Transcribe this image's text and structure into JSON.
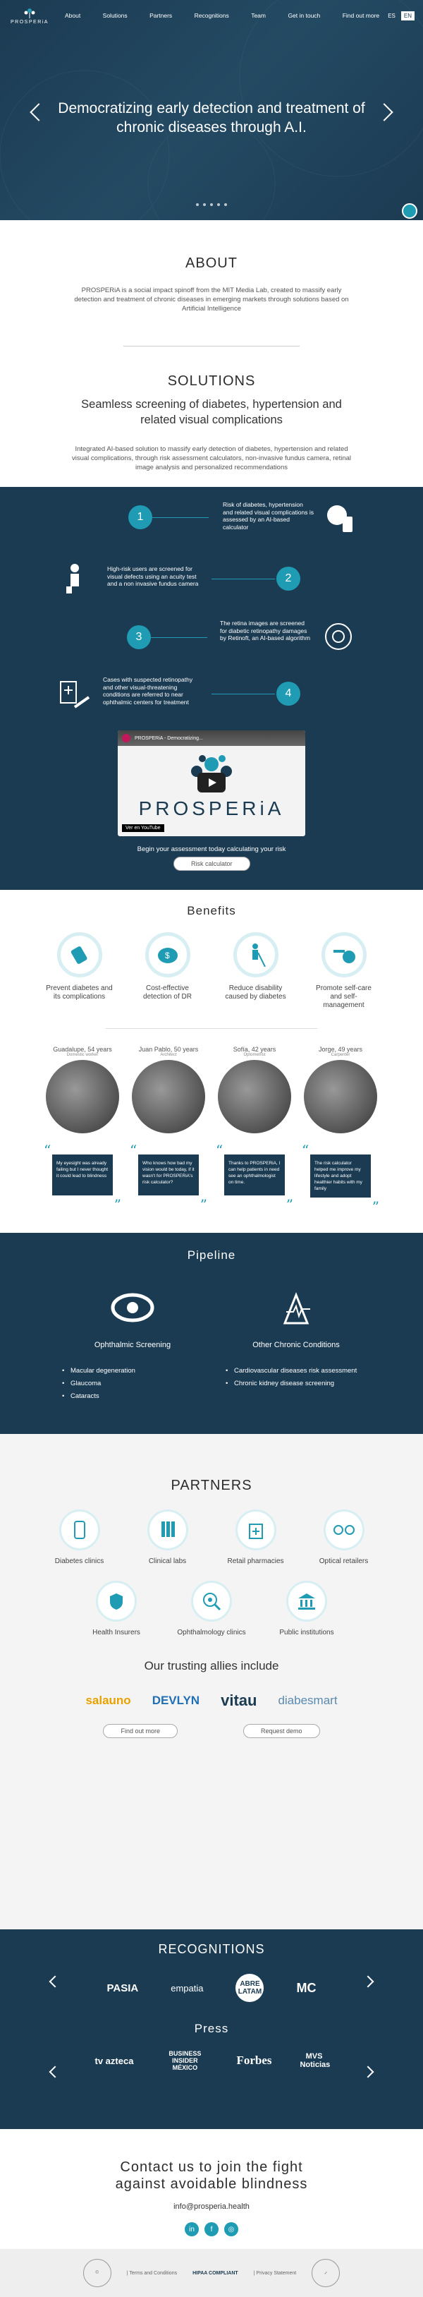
{
  "brand": "PROSPERiA",
  "nav": [
    "About",
    "Solutions",
    "Partners",
    "Recognitions",
    "Team",
    "Get in touch",
    "Find out more"
  ],
  "lang": [
    "ES",
    "EN"
  ],
  "hero": {
    "title": "Democratizing early detection and treatment of chronic diseases through A.I."
  },
  "about": {
    "title": "ABOUT",
    "text": "PROSPERiA is a social impact spinoff from the MIT Media Lab, created to massify early detection and treatment of chronic diseases in emerging markets through solutions based on Artificial Intelligence"
  },
  "solutions": {
    "title": "SOLUTIONS",
    "subtitle": "Seamless screening of diabetes, hypertension and related visual complications",
    "text": "Integrated AI-based solution to massify early detection of diabetes, hypertension and related visual complications, through risk assessment calculators, non-invasive fundus camera, retinal image analysis and personalized recommendations"
  },
  "steps": [
    {
      "n": "1",
      "text": "Risk of diabetes, hypertension and related visual complications is assessed by an AI-based calculator"
    },
    {
      "n": "2",
      "text": "High-risk users are screened for visual defects using an acuity test and a non invasive fundus camera"
    },
    {
      "n": "3",
      "text": "The retina images are screened for diabetic retinopathy damages by Retinoft, an AI-based algorithm"
    },
    {
      "n": "4",
      "text": "Cases with suspected retinopathy and other visual-threatening conditions are referred to near ophthalmic centers for treatment"
    }
  ],
  "video": {
    "title": "PROSPERiA - Democratizing...",
    "brand": "PROSPERiA",
    "watch": "Ver en YouTube"
  },
  "cta": {
    "text": "Begin your assessment today calculating your risk",
    "button": "Risk calculator"
  },
  "benefits": {
    "title": "Benefits",
    "items": [
      "Prevent diabetes and its complications",
      "Cost-effective detection of DR",
      "Reduce disability caused by diabetes",
      "Promote self-care and self-management"
    ]
  },
  "testimonials": [
    {
      "name": "Guadalupe, 54 years",
      "role": "Domestic worker",
      "quote": "My eyesight was already failing but I never thought it could lead to blindness"
    },
    {
      "name": "Juan Pablo, 50 years",
      "role": "Architect",
      "quote": "Who knows how bad my vision would be today, if it wasn't for PROSPERiA's risk calculator?"
    },
    {
      "name": "Sofía, 42 years",
      "role": "Optometrist",
      "quote": "Thanks to PROSPERiA, I can help patients in need see an ophthalmologist on time."
    },
    {
      "name": "Jorge, 49 years",
      "role": "Carpenter",
      "quote": "The risk calculator helped me improve my lifestyle and adopt healthier habits with my family"
    }
  ],
  "pipeline": {
    "title": "Pipeline",
    "col1": {
      "title": "Ophthalmic Screening",
      "items": [
        "Macular degeneration",
        "Glaucoma",
        "Cataracts"
      ]
    },
    "col2": {
      "title": "Other Chronic Conditions",
      "items": [
        "Cardiovascular diseases risk assessment",
        "Chronic kidney disease screening"
      ]
    }
  },
  "partners": {
    "title": "PARTNERS",
    "row1": [
      "Diabetes clinics",
      "Clinical labs",
      "Retail pharmacies",
      "Optical retailers"
    ],
    "row2": [
      "Health Insurers",
      "Ophthalmology clinics",
      "Public institutions"
    ],
    "allies_title": "Our trusting allies include",
    "allies": [
      "salauno",
      "DEVLYN",
      "vitau",
      "diabesmart"
    ],
    "buttons": [
      "Find out more",
      "Request demo"
    ]
  },
  "recognitions": {
    "title": "RECOGNITIONS",
    "logos": [
      "PASIA",
      "empatia",
      "ABRE LATAM",
      "MC"
    ]
  },
  "press": {
    "title": "Press",
    "logos": [
      "tv azteca",
      "BUSINESS INSIDER MÉXICO",
      "Forbes",
      "MVS Noticias"
    ]
  },
  "contact": {
    "title": "Contact us to join the fight against avoidable blindness",
    "email": "info@prosperia.health",
    "social": [
      "in",
      "f",
      "◎"
    ]
  },
  "footer": {
    "terms": "| Terms and Conditions",
    "hipaa": "HIPAA COMPLIANT",
    "privacy": "| Privacy Statement"
  },
  "colors": {
    "navy": "#1b3b52",
    "teal": "#1f9cb4"
  }
}
